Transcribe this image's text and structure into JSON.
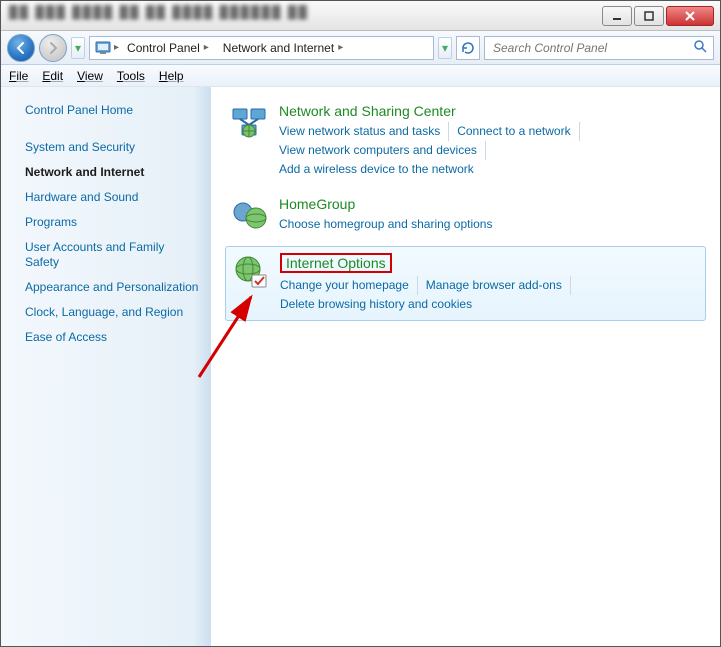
{
  "titlebar": {},
  "breadcrumb": {
    "seg1": "Control Panel",
    "seg2": "Network and Internet"
  },
  "search": {
    "placeholder": "Search Control Panel"
  },
  "menu": {
    "file": "File",
    "edit": "Edit",
    "view": "View",
    "tools": "Tools",
    "help": "Help"
  },
  "sidebar": {
    "home": "Control Panel Home",
    "items": [
      "System and Security",
      "Network and Internet",
      "Hardware and Sound",
      "Programs",
      "User Accounts and Family Safety",
      "Appearance and Personalization",
      "Clock, Language, and Region",
      "Ease of Access"
    ],
    "active_index": 1
  },
  "categories": [
    {
      "icon": "network-sharing-icon",
      "title": "Network and Sharing Center",
      "links": [
        "View network status and tasks",
        "Connect to a network",
        "View network computers and devices",
        "Add a wireless device to the network"
      ]
    },
    {
      "icon": "homegroup-icon",
      "title": "HomeGroup",
      "links": [
        "Choose homegroup and sharing options"
      ]
    },
    {
      "icon": "internet-options-icon",
      "title": "Internet Options",
      "highlight": true,
      "boxed": true,
      "links": [
        "Change your homepage",
        "Manage browser add-ons",
        "Delete browsing history and cookies"
      ]
    }
  ]
}
